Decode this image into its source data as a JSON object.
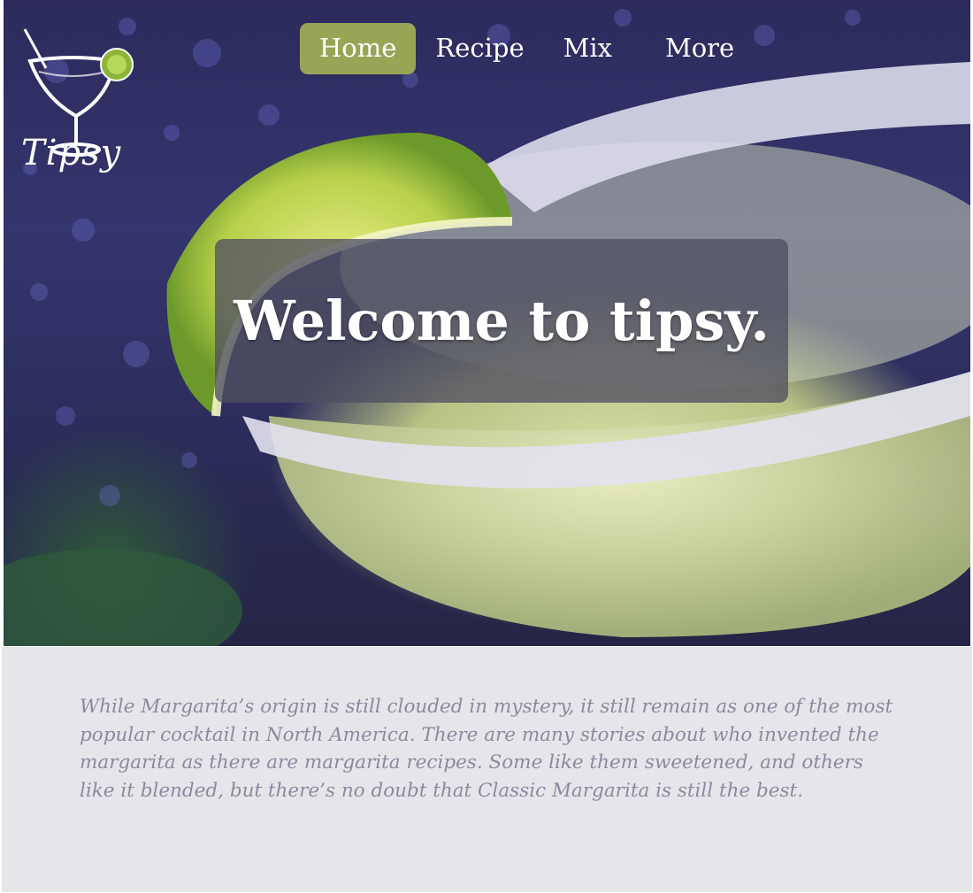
{
  "brand": {
    "name": "Tipsy"
  },
  "nav": {
    "items": [
      {
        "label": "Home",
        "active": true
      },
      {
        "label": "Recipe",
        "active": false
      },
      {
        "label": "Mix",
        "active": false
      },
      {
        "label": "More",
        "active": false
      }
    ]
  },
  "hero": {
    "title": "Welcome to tipsy."
  },
  "intro": {
    "text": "While Margarita’s origin is still clouded in mystery, it still remain as one of the most popular cocktail in North America. There are many stories about who invented the margarita as there are margarita recipes. Some like them sweetened, and others like it blended, but there’s no doubt that Classic Margarita is still the best."
  },
  "colors": {
    "nav_active": "#9aa456",
    "content_bg": "#e6e6ea",
    "content_text": "#8a8a9e",
    "welcome_box": "#505060"
  }
}
